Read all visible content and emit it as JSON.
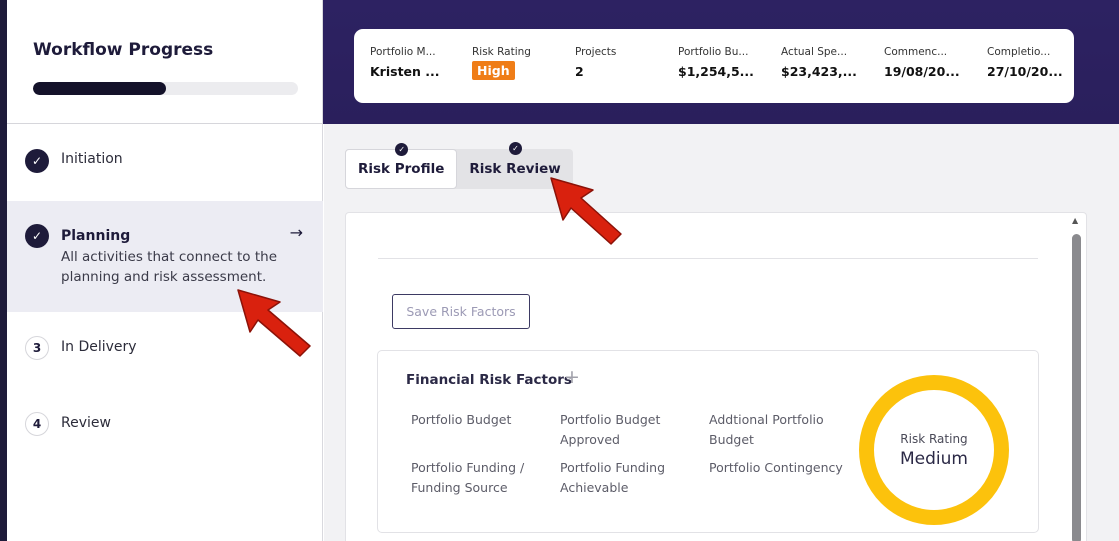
{
  "sidebar": {
    "title": "Workflow Progress",
    "progress": 0.5,
    "steps": [
      {
        "label": "Initiation",
        "status": "done",
        "icon": "check-icon"
      },
      {
        "label": "Planning",
        "status": "done",
        "icon": "check-icon",
        "description": "All activities that connect to the planning and risk assessment."
      },
      {
        "label": "In Delivery",
        "number": "3"
      },
      {
        "label": "Review",
        "number": "4"
      }
    ]
  },
  "summary": {
    "items": [
      {
        "label": "Portfolio M...",
        "value": "Kristen ..."
      },
      {
        "label": "Risk Rating",
        "value": "High"
      },
      {
        "label": "Projects",
        "value": "2"
      },
      {
        "label": "Portfolio Bu...",
        "value": "$1,254,5..."
      },
      {
        "label": "Actual Spe...",
        "value": "$23,423,..."
      },
      {
        "label": "Commenc...",
        "value": "19/08/20..."
      },
      {
        "label": "Completio...",
        "value": "27/10/20..."
      }
    ]
  },
  "tabs": [
    {
      "label": "Risk Profile",
      "active": true
    },
    {
      "label": "Risk Review",
      "active": false
    }
  ],
  "content": {
    "save_button": "Save Risk Factors",
    "financial": {
      "title": "Financial Risk Factors",
      "factors": [
        "Portfolio Budget",
        "Portfolio Budget Approved",
        "Addtional Portfolio Budget",
        "Portfolio Funding / Funding Source",
        "Portfolio Funding Achievable",
        "Portfolio Contingency"
      ],
      "gauge_label": "Risk Rating",
      "gauge_value": "Medium"
    }
  },
  "colors": {
    "brand_dark": "#1e1b3a",
    "banner": "#2d2262",
    "high": "#ef7d17",
    "gauge": "#fcc20c",
    "annotation": "#d9210e"
  }
}
